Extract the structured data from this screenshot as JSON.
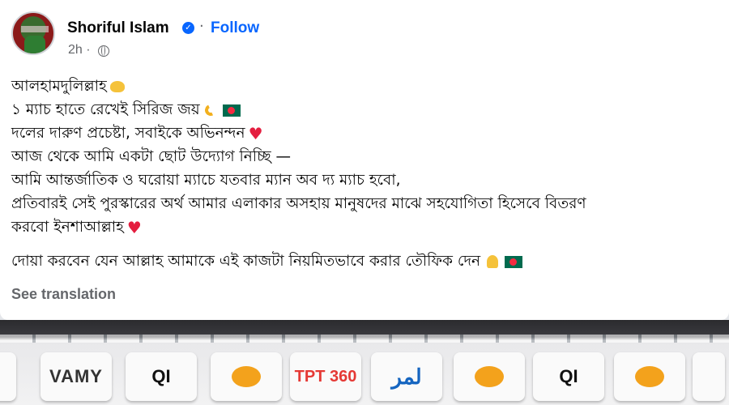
{
  "post": {
    "author": "Shoriful Islam",
    "follow_label": "Follow",
    "separator": "·",
    "time": "2h ·",
    "verified_icon": "verified-badge-icon",
    "body_lines": [
      "আলহামদুলিল্লাহ",
      "১ ম্যাচ হাতে রেখেই সিরিজ জয়",
      "দলের দারুণ প্রচেষ্টা, সবাইকে অভিনন্দন",
      "আজ থেকে আমি একটা ছোট উদ্যোগ নিচ্ছি —",
      "আমি আন্তর্জাতিক ও ঘরোয়া ম্যাচে যতবার ম্যান অব দ্য ম্যাচ হবো,",
      "প্রতিবারই সেই পুরস্কারের অর্থ আমার এলাকার  অসহায় মানুষদের মাঝে সহযোগিতা হিসেবে বিতরণ",
      "করবো ইনশাআল্লাহ",
      "দোয়া করবেন যেন আল্লাহ আমাকে এই কাজটা নিয়মিতভাবে করার তৌফিক দেন"
    ],
    "see_translation": "See translation"
  },
  "banner": {
    "sponsors": [
      "VAMY",
      "TPT 360",
      "لمر",
      "QI"
    ]
  },
  "colors": {
    "accent": "#0866ff",
    "secondary_text": "#65676b",
    "heart": "#e41e3f"
  }
}
